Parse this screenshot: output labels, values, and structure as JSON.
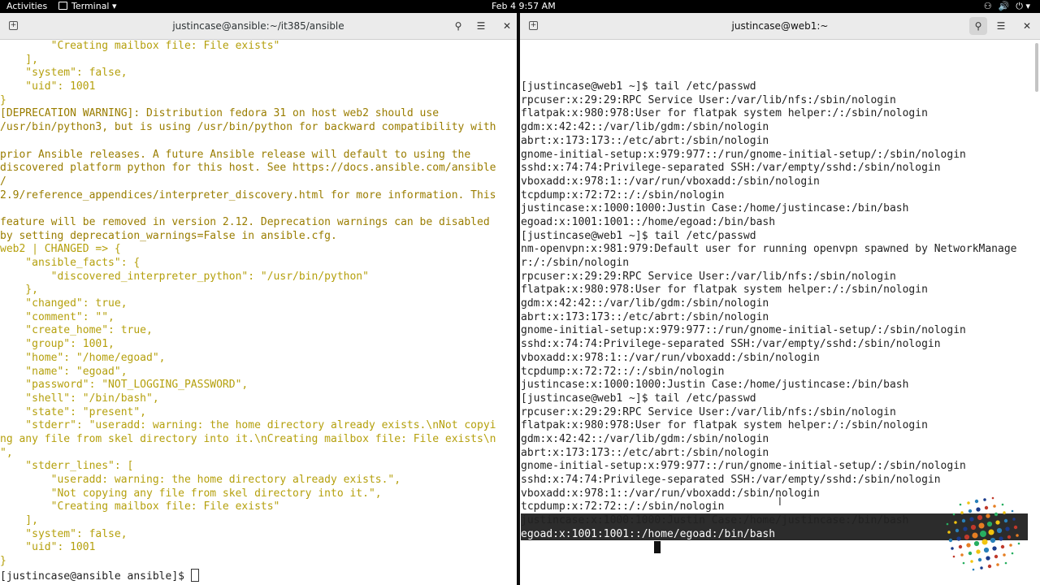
{
  "topbar": {
    "activities": "Activities",
    "app": "Terminal",
    "clock": "Feb 4  9:57 AM",
    "tray": [
      "⚇",
      "🔊",
      "⏻"
    ]
  },
  "left_window": {
    "title": "justincase@ansible:~/it385/ansible",
    "lines": [
      {
        "cls": "y",
        "t": "        \"Creating mailbox file: File exists\""
      },
      {
        "cls": "y",
        "t": "    ],"
      },
      {
        "cls": "y",
        "t": "    \"system\": false,"
      },
      {
        "cls": "y",
        "t": "    \"uid\": 1001"
      },
      {
        "cls": "y",
        "t": "}"
      },
      {
        "cls": "m",
        "t": "[DEPRECATION WARNING]: Distribution fedora 31 on host web2 should use "
      },
      {
        "cls": "m",
        "t": "/usr/bin/python3, but is using /usr/bin/python for backward compatibility with"
      },
      {
        "cls": "m",
        "t": ""
      },
      {
        "cls": "m",
        "t": "prior Ansible releases. A future Ansible release will default to using the "
      },
      {
        "cls": "m",
        "t": "discovered platform python for this host. See https://docs.ansible.com/ansible"
      },
      {
        "cls": "m",
        "t": "/"
      },
      {
        "cls": "m",
        "t": "2.9/reference_appendices/interpreter_discovery.html for more information. This"
      },
      {
        "cls": "m",
        "t": ""
      },
      {
        "cls": "m",
        "t": "feature will be removed in version 2.12. Deprecation warnings can be disabled"
      },
      {
        "cls": "m",
        "t": "by setting deprecation_warnings=False in ansible.cfg."
      },
      {
        "cls": "y",
        "t": "web2 | CHANGED => {"
      },
      {
        "cls": "y",
        "t": "    \"ansible_facts\": {"
      },
      {
        "cls": "y",
        "t": "        \"discovered_interpreter_python\": \"/usr/bin/python\""
      },
      {
        "cls": "y",
        "t": "    },"
      },
      {
        "cls": "y",
        "t": "    \"changed\": true,"
      },
      {
        "cls": "y",
        "t": "    \"comment\": \"\","
      },
      {
        "cls": "y",
        "t": "    \"create_home\": true,"
      },
      {
        "cls": "y",
        "t": "    \"group\": 1001,"
      },
      {
        "cls": "y",
        "t": "    \"home\": \"/home/egoad\","
      },
      {
        "cls": "y",
        "t": "    \"name\": \"egoad\","
      },
      {
        "cls": "y",
        "t": "    \"password\": \"NOT_LOGGING_PASSWORD\","
      },
      {
        "cls": "y",
        "t": "    \"shell\": \"/bin/bash\","
      },
      {
        "cls": "y",
        "t": "    \"state\": \"present\","
      },
      {
        "cls": "y",
        "t": "    \"stderr\": \"useradd: warning: the home directory already exists.\\nNot copyi"
      },
      {
        "cls": "y",
        "t": "ng any file from skel directory into it.\\nCreating mailbox file: File exists\\n"
      },
      {
        "cls": "y",
        "t": "\","
      },
      {
        "cls": "y",
        "t": "    \"stderr_lines\": ["
      },
      {
        "cls": "y",
        "t": "        \"useradd: warning: the home directory already exists.\","
      },
      {
        "cls": "y",
        "t": "        \"Not copying any file from skel directory into it.\","
      },
      {
        "cls": "y",
        "t": "        \"Creating mailbox file: File exists\""
      },
      {
        "cls": "y",
        "t": "    ],"
      },
      {
        "cls": "y",
        "t": "    \"system\": false,"
      },
      {
        "cls": "y",
        "t": "    \"uid\": 1001"
      },
      {
        "cls": "y",
        "t": "}"
      }
    ],
    "prompt": "[justincase@ansible ansible]$ "
  },
  "right_window": {
    "title": "justincase@web1:~",
    "lines": [
      "[justincase@web1 ~]$ tail /etc/passwd",
      "rpcuser:x:29:29:RPC Service User:/var/lib/nfs:/sbin/nologin",
      "flatpak:x:980:978:User for flatpak system helper:/:/sbin/nologin",
      "gdm:x:42:42::/var/lib/gdm:/sbin/nologin",
      "abrt:x:173:173::/etc/abrt:/sbin/nologin",
      "gnome-initial-setup:x:979:977::/run/gnome-initial-setup/:/sbin/nologin",
      "sshd:x:74:74:Privilege-separated SSH:/var/empty/sshd:/sbin/nologin",
      "vboxadd:x:978:1::/var/run/vboxadd:/sbin/nologin",
      "tcpdump:x:72:72::/:/sbin/nologin",
      "justincase:x:1000:1000:Justin Case:/home/justincase:/bin/bash",
      "egoad:x:1001:1001::/home/egoad:/bin/bash",
      "[justincase@web1 ~]$ tail /etc/passwd",
      "nm-openvpn:x:981:979:Default user for running openvpn spawned by NetworkManage",
      "r:/:/sbin/nologin",
      "rpcuser:x:29:29:RPC Service User:/var/lib/nfs:/sbin/nologin",
      "flatpak:x:980:978:User for flatpak system helper:/:/sbin/nologin",
      "gdm:x:42:42::/var/lib/gdm:/sbin/nologin",
      "abrt:x:173:173::/etc/abrt:/sbin/nologin",
      "gnome-initial-setup:x:979:977::/run/gnome-initial-setup/:/sbin/nologin",
      "sshd:x:74:74:Privilege-separated SSH:/var/empty/sshd:/sbin/nologin",
      "vboxadd:x:978:1::/var/run/vboxadd:/sbin/nologin",
      "tcpdump:x:72:72::/:/sbin/nologin",
      "justincase:x:1000:1000:Justin Case:/home/justincase:/bin/bash",
      "[justincase@web1 ~]$ tail /etc/passwd",
      "rpcuser:x:29:29:RPC Service User:/var/lib/nfs:/sbin/nologin",
      "flatpak:x:980:978:User for flatpak system helper:/:/sbin/nologin",
      "gdm:x:42:42::/var/lib/gdm:/sbin/nologin",
      "abrt:x:173:173::/etc/abrt:/sbin/nologin",
      "gnome-initial-setup:x:979:977::/run/gnome-initial-setup/:/sbin/nologin",
      "sshd:x:74:74:Privilege-separated SSH:/var/empty/sshd:/sbin/nologin",
      "vboxadd:x:978:1::/var/run/vboxadd:/sbin/nologin",
      "tcpdump:x:72:72::/:/sbin/nologin",
      "justincase:x:1000:1000:Justin Case:/home/justincase:/bin/bash"
    ],
    "selected_line": "egoad:x:1001:1001::/home/egoad:/bin/bash",
    "prompt": "[justincase@web1 ~]$ "
  },
  "colors": {
    "yellow": "#b5a00d",
    "selection": "#2c2c2c"
  },
  "icons": [
    "new-tab-icon",
    "search-icon",
    "hamburger-menu-icon",
    "close-icon"
  ]
}
